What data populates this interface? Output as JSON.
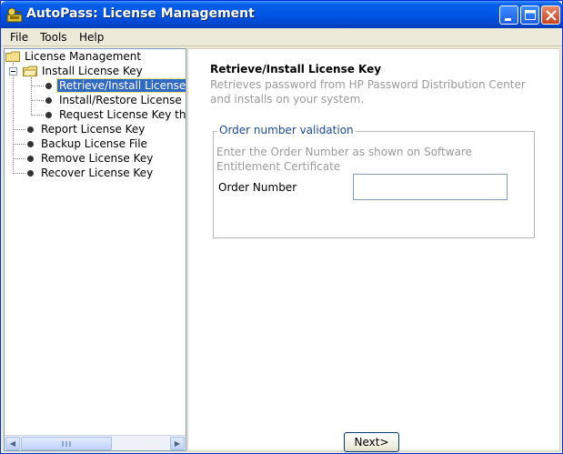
{
  "window": {
    "title": "AutoPass: License Management",
    "app_icon": "key-pass-icon"
  },
  "title_buttons": {
    "minimize": "minimize-icon",
    "maximize": "maximize-icon",
    "close": "close-icon"
  },
  "menu": {
    "items": [
      "File",
      "Tools",
      "Help"
    ]
  },
  "tree": {
    "root": "License Management",
    "install_group": "Install License Key",
    "install_children": [
      "Retrieve/Install License Key",
      "Install/Restore License Key",
      "Request License Key thro"
    ],
    "other_items": [
      "Report License Key",
      "Backup License File",
      "Remove License Key",
      "Recover License Key"
    ],
    "selected": "Retrieve/Install License Key"
  },
  "content": {
    "heading": "Retrieve/Install License Key",
    "description": "Retrieves password from HP Password Distribution Center and installs on your system.",
    "group_title": "Order number validation",
    "hint": "Enter the Order Number as shown on Software Entitlement Certificate",
    "order_label": "Order Number",
    "order_value": "",
    "next_label": "Next>"
  },
  "colors": {
    "titlebar": "#0055e5",
    "selection": "#316ac5",
    "legend_text": "#1a4a9c",
    "muted_text": "#9a9a9a"
  }
}
